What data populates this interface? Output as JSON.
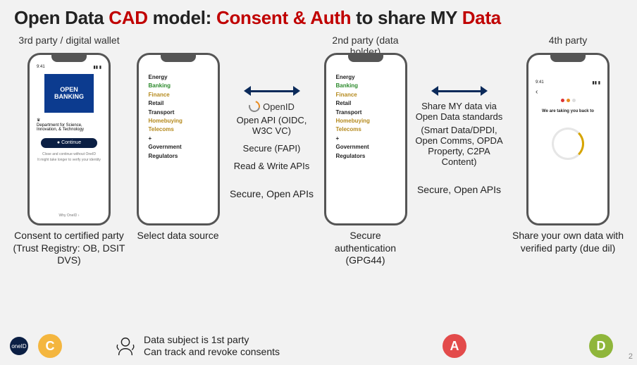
{
  "title": {
    "pre": "Open Data ",
    "cad": "CAD",
    "mid": " model: ",
    "consent": "Consent & Auth",
    "mid2": " to share MY ",
    "data": "Data"
  },
  "parties": {
    "third": "3rd party / digital wallet",
    "second": "2nd party (data holder)",
    "fourth": "4th party"
  },
  "phone1": {
    "time": "9:41",
    "tile": "OPEN BANKING",
    "dept": "Department for Science, Innovation, & Technology",
    "button": "● Continue",
    "fineprint1": "Close and continue without OneID",
    "fineprint2": "It might take longer to verify your identity",
    "footer": "Why OneID  ›"
  },
  "sectors": {
    "energy": "Energy",
    "banking": "Banking",
    "finance": "Finance",
    "retail": "Retail",
    "transport": "Transport",
    "homebuying": "Homebuying",
    "telecoms": "Telecoms",
    "plus": "+",
    "government": "Government",
    "regulators": "Regulators"
  },
  "mid1": {
    "logo": "OpenID",
    "line1": "Open API (OIDC, W3C VC)",
    "line2": "Secure (FAPI)",
    "line3": "Read & Write APIs"
  },
  "mid2": {
    "line1": "Share MY data via Open Data standards",
    "line2": "(Smart Data/DPDI, Open Comms, OPDA Property, C2PA Content)"
  },
  "phone4": {
    "time": "9:41",
    "msg": "We are taking you back to"
  },
  "captions": {
    "c1": "Consent to certified party (Trust Registry: OB, DSIT DVS)",
    "c2": "Select data source",
    "c3": "Secure, Open APIs",
    "c4": "Secure authentication (GPG44)",
    "c5": "Secure, Open APIs",
    "c6": "Share your own data with verified party (due dil)"
  },
  "footer": {
    "one": "oneID",
    "C": "C",
    "A": "A",
    "D": "D",
    "subject_l1": "Data subject is 1st party",
    "subject_l2": "Can track and revoke consents"
  },
  "page": "2"
}
